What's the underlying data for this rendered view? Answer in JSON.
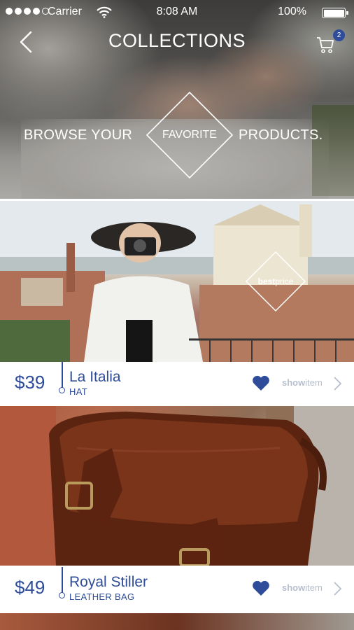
{
  "status_bar": {
    "carrier": "Carrier",
    "time": "8:08 AM",
    "battery": "100%"
  },
  "nav": {
    "title": "COLLECTIONS",
    "cart_count": "2"
  },
  "hero": {
    "text_left": "BROWSE YOUR",
    "text_center": "FAVORITE",
    "text_right": "PRODUCTS."
  },
  "badge": {
    "bold": "best",
    "light": "price"
  },
  "products": [
    {
      "price": "$39",
      "name": "La Italia",
      "type": "HAT",
      "action_bold": "show",
      "action_light": "item"
    },
    {
      "price": "$49",
      "name": "Royal Stiller",
      "type": "LEATHER BAG",
      "action_bold": "show",
      "action_light": "item"
    }
  ],
  "colors": {
    "accent": "#2e4c9a",
    "muted": "#b7bfce"
  }
}
